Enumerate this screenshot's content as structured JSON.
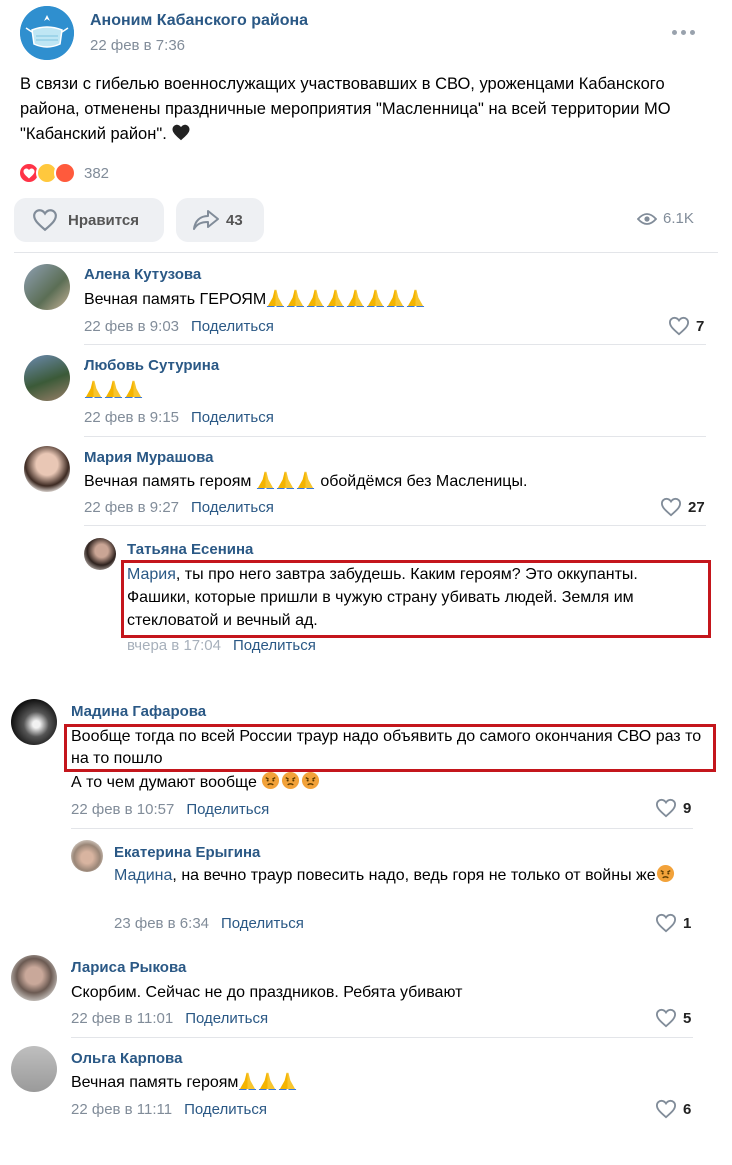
{
  "post": {
    "author": "Аноним Кабанского района",
    "date": "22 фев в 7:36",
    "text": "В связи с гибелью военнослужащих участвовавших в СВО, уроженцами Кабанского района, отменены праздничные мероприятия \"Масленница\" на всей территории МО \"Кабанский район\".",
    "reactions_count": "382",
    "like_label": "Нравится",
    "share_count": "43",
    "views": "6.1K"
  },
  "share_label": "Поделиться",
  "comments": [
    {
      "author": "Алена Кутузова",
      "text": "Вечная память ГЕРОЯМ",
      "date": "22 фев в 9:03",
      "likes": "7"
    },
    {
      "author": "Любовь Сутурина",
      "text": "",
      "date": "22 фев в 9:15",
      "likes": ""
    },
    {
      "author": "Мария Мурашова",
      "text": "Вечная память героям",
      "text_after": "обойдёмся без Масленицы.",
      "date": "22 фев в 9:27",
      "likes": "27"
    },
    {
      "author": "Татьяна Есенина",
      "mention": "Мария",
      "text": ", ты про него завтра забудешь. Каким героям? Это оккупанты. Фашики, которые пришли в чужую страну убивать людей. Земля им стекловатой и вечный ад.",
      "date": "вчера в 17:04",
      "likes": ""
    },
    {
      "author": "Мадина Гафарова",
      "text": "Вообще тогда по всей России траур надо объявить до самого окончания СВО раз то на то пошло",
      "text2": "А то чем думают вообще",
      "date": "22 фев в 10:57",
      "likes": "9"
    },
    {
      "author": "Екатерина Ерыгина",
      "mention": "Мадина",
      "text": ", на вечно траур повесить надо, ведь горя не только от войны же",
      "date": "23 фев в 6:34",
      "likes": "1"
    },
    {
      "author": "Лариса Рыкова",
      "text": "Скорбим. Сейчас не до праздников. Ребята убивают",
      "date": "22 фев в 11:01",
      "likes": "5"
    },
    {
      "author": "Ольга Карпова",
      "text": "Вечная память героям",
      "date": "22 фев в 11:11",
      "likes": "6"
    }
  ],
  "colors": {
    "link": "#2a5885",
    "meta": "#818c99",
    "highlight": "#c4161c"
  }
}
